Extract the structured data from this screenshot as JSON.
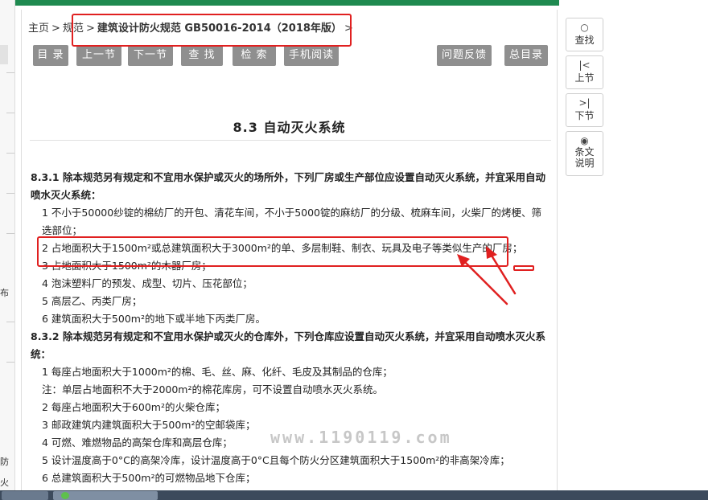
{
  "breadcrumb": {
    "home": "主页",
    "sep": ">",
    "level1": "规范",
    "level2": "建筑设计防火规范 GB50016-2014（2018年版）"
  },
  "toolbar": {
    "toc": "目 录",
    "prev": "上一节",
    "next": "下一节",
    "find": "查 找",
    "search": "检 索",
    "mobile": "手机阅读",
    "feedback": "问题反馈",
    "master_toc": "总目录"
  },
  "section_title": "8.3 自动灭火系统",
  "body": {
    "p1": "8.3.1 除本规范另有规定和不宜用水保护或灭火的场所外，下列厂房或生产部位应设置自动灭火系统，并宜采用自动喷水灭火系统：",
    "p1_items": [
      "1 不小于50000纱锭的棉纺厂的开包、清花车间，不小于5000锭的麻纺厂的分级、梳麻车间，火柴厂的烤梗、筛选部位；",
      "2 占地面积大于1500m²或总建筑面积大于3000m²的单、多层制鞋、制衣、玩具及电子等类似生产的厂房；",
      "3 占地面积大于1500m²的木器厂房；",
      "4 泡沫塑料厂的预发、成型、切片、压花部位；",
      "5 高层乙、丙类厂房；",
      "6 建筑面积大于500m²的地下或半地下丙类厂房。"
    ],
    "p2": "8.3.2 除本规范另有规定和不宜用水保护或灭火的仓库外，下列仓库应设置自动灭火系统，并宜采用自动喷水灭火系统：",
    "p2_items": [
      "1 每座占地面积大于1000m²的棉、毛、丝、麻、化纤、毛皮及其制品的仓库；",
      "注：单层占地面积不大于2000m²的棉花库房，可不设置自动喷水灭火系统。",
      "2 每座占地面积大于600m²的火柴仓库；",
      "3 邮政建筑内建筑面积大于500m²的空邮袋库；",
      "4 可燃、难燃物品的高架仓库和高层仓库；",
      "5 设计温度高于0°C的高架冷库，设计温度高于0°C且每个防火分区建筑面积大于1500m²的非高架冷库；",
      "6 总建筑面积大于500m²的可燃物品地下仓库；"
    ]
  },
  "sidebar": {
    "find_label": "查找",
    "prev_label": "上节",
    "next_label": "下节",
    "explain_label": "条文说明"
  },
  "left_strip": {
    "char1": "布",
    "char2": "防",
    "char3": "火"
  },
  "watermark": "www.1190119.com",
  "colors": {
    "accent_green": "#1f8a50",
    "button_gray": "#8f8f8f",
    "annotation_red": "#e02020"
  },
  "icons": {
    "find": "search-icon",
    "prev": "skip-back-icon",
    "next": "skip-forward-icon",
    "explain": "eye-icon"
  }
}
